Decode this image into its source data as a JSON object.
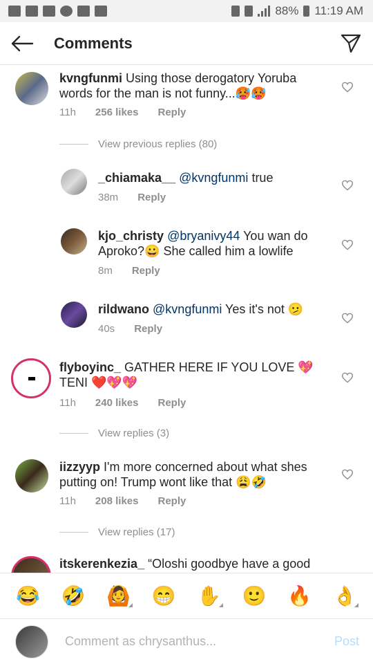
{
  "status_bar": {
    "battery": "88%",
    "time": "11:19 AM"
  },
  "header": {
    "title": "Comments",
    "back_icon": "arrow-left-icon",
    "share_icon": "paper-plane-icon"
  },
  "comments": [
    {
      "username": "kvngfunmi",
      "text": "Using those derogatory Yoruba words for the man is not funny...🥵🥵",
      "time": "11h",
      "likes": "256 likes",
      "reply": "Reply"
    },
    {
      "view_replies": "View previous replies (80)"
    },
    {
      "username": "_chiamaka__",
      "mention": "@kvngfunmi",
      "text": "true",
      "time": "38m",
      "reply": "Reply"
    },
    {
      "username": "kjo_christy",
      "mention": "@bryanivy44",
      "text": "You wan do Aproko?😀 She called him a lowlife",
      "time": "8m",
      "reply": "Reply"
    },
    {
      "username": "rildwano",
      "mention": "@kvngfunmi",
      "text": "Yes it's not 🫤",
      "time": "40s",
      "reply": "Reply"
    },
    {
      "username": "flyboyinc_",
      "text": "GATHER HERE IF YOU LOVE 💖 TENI ❤️💖💖",
      "time": "11h",
      "likes": "240 likes",
      "reply": "Reply"
    },
    {
      "view_replies": "View replies (3)"
    },
    {
      "username": "iizzyyp",
      "text": "I'm more concerned about what shes putting on! Trump wont like that 😩🤣",
      "time": "11h",
      "likes": "208 likes",
      "reply": "Reply"
    },
    {
      "view_replies": "View replies (17)"
    },
    {
      "username": "itskerenkezia_",
      "text": "“Oloshi goodbye have a good"
    }
  ],
  "emoji_bar": [
    "😂",
    "🤣",
    "🙆",
    "😁",
    "✋",
    "🙂",
    "🔥",
    "👌"
  ],
  "composer": {
    "placeholder": "Comment as chrysanthus...",
    "post_label": "Post"
  }
}
